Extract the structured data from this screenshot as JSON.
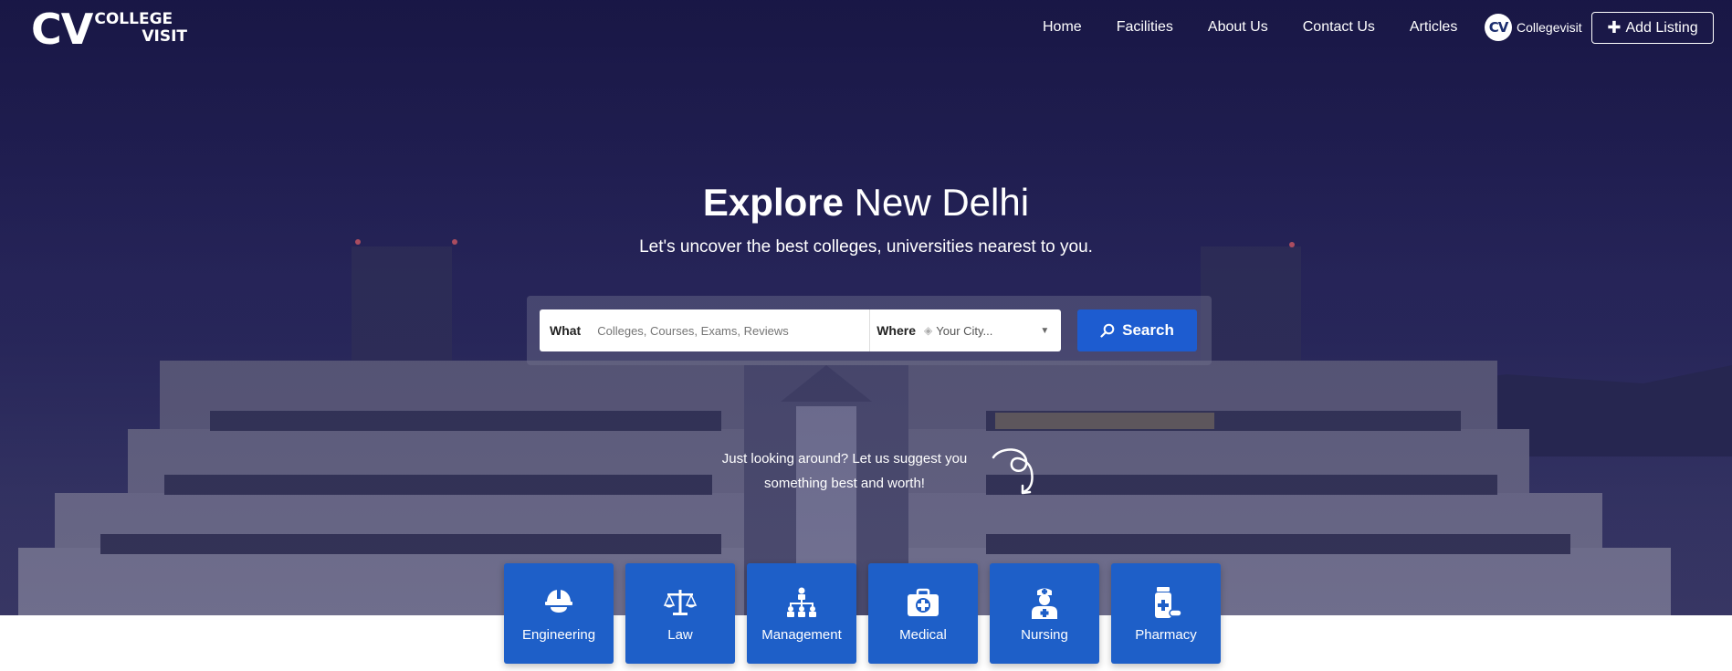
{
  "brand": {
    "logo_initials": "CV",
    "logo_line1": "COLLEGE",
    "logo_line2": "VISIT"
  },
  "nav": [
    {
      "label": "Home"
    },
    {
      "label": "Facilities"
    },
    {
      "label": "About Us"
    },
    {
      "label": "Contact Us"
    },
    {
      "label": "Articles"
    }
  ],
  "user": {
    "avatar_initials": "CV",
    "name": "Collegevisit"
  },
  "add_listing": {
    "label": "Add Listing",
    "icon": "plus-icon"
  },
  "hero": {
    "title_bold": "Explore",
    "title_rest": "New Delhi",
    "subtitle": "Let's uncover the best colleges, universities nearest to you."
  },
  "search": {
    "what_label": "What",
    "what_placeholder": "Colleges, Courses, Exams, Reviews",
    "where_label": "Where",
    "where_value": "Your City...",
    "button_label": "Search",
    "button_icon": "search-icon"
  },
  "suggest": {
    "line1": "Just looking around? Let us suggest you",
    "line2": "something best and worth!"
  },
  "categories": [
    {
      "label": "Engineering",
      "icon": "engineer-helmet-icon"
    },
    {
      "label": "Law",
      "icon": "scales-icon"
    },
    {
      "label": "Management",
      "icon": "org-chart-icon"
    },
    {
      "label": "Medical",
      "icon": "medical-kit-icon"
    },
    {
      "label": "Nursing",
      "icon": "nurse-icon"
    },
    {
      "label": "Pharmacy",
      "icon": "medicine-bottle-icon"
    }
  ],
  "colors": {
    "accent": "#1e5fc8",
    "hero_dark": "#1c1a4a"
  }
}
